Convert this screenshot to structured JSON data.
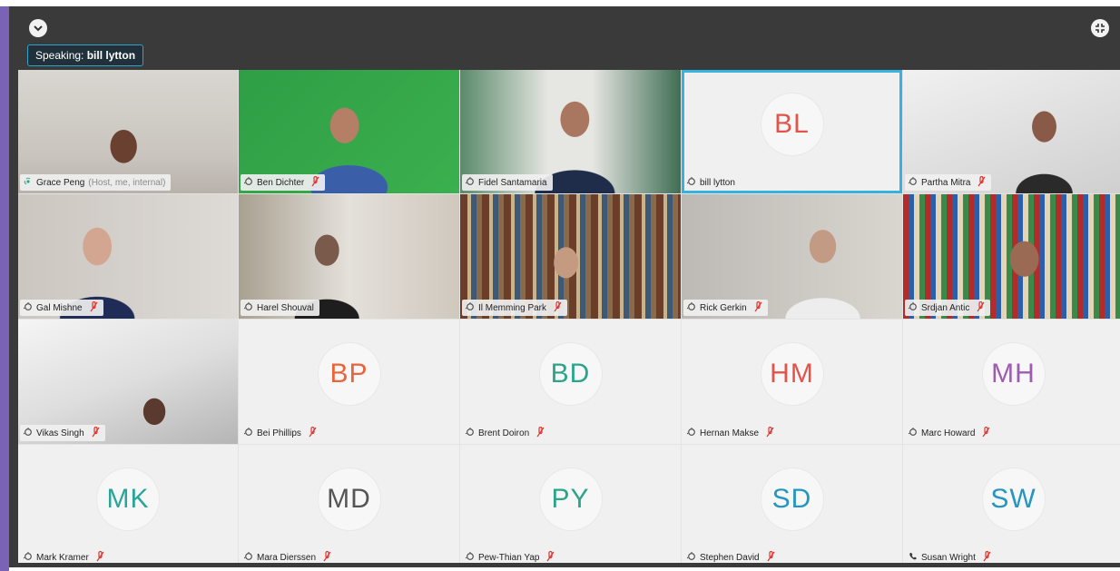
{
  "window": {
    "speaking_prefix": "Speaking:",
    "speaking_name": "bill lytton",
    "collapse_icon": "chevron-down-icon",
    "fullscreen_icon": "exit-fullscreen-icon"
  },
  "colors": {
    "accent": "#35b2dd",
    "mute_red": "#e0322d",
    "window_bg": "#3a3a3a",
    "purple_strip": "#7a62b5"
  },
  "participants": [
    {
      "name": "Grace Peng",
      "note": "(Host, me, internal)",
      "type": "video",
      "audio": "speaking",
      "muted": false
    },
    {
      "name": "Ben Dichter",
      "type": "video",
      "audio": "mic",
      "muted": true
    },
    {
      "name": "Fidel Santamaria",
      "type": "video",
      "audio": "mic",
      "muted": false
    },
    {
      "name": "bill lytton",
      "initials": "BL",
      "initials_color": "#e0544a",
      "type": "avatar",
      "audio": "mic",
      "muted": false,
      "active": true
    },
    {
      "name": "Partha Mitra",
      "type": "video",
      "audio": "mic",
      "muted": true
    },
    {
      "name": "Gal Mishne",
      "type": "video",
      "audio": "mic",
      "muted": true
    },
    {
      "name": "Harel Shouval",
      "type": "video",
      "audio": "mic",
      "muted": false
    },
    {
      "name": "Il Memming Park",
      "type": "video",
      "audio": "mic",
      "muted": true
    },
    {
      "name": "Rick Gerkin",
      "type": "video",
      "audio": "mic",
      "muted": true
    },
    {
      "name": "Srdjan Antic",
      "type": "video",
      "audio": "mic",
      "muted": true
    },
    {
      "name": "Vikas Singh",
      "type": "video",
      "audio": "mic",
      "muted": true
    },
    {
      "name": "Bei Phillips",
      "initials": "BP",
      "initials_color": "#e8643c",
      "type": "avatar",
      "audio": "mic",
      "muted": true
    },
    {
      "name": "Brent Doiron",
      "initials": "BD",
      "initials_color": "#2aa58a",
      "type": "avatar",
      "audio": "mic",
      "muted": true
    },
    {
      "name": "Hernan Makse",
      "initials": "HM",
      "initials_color": "#e0544a",
      "type": "avatar",
      "audio": "mic",
      "muted": true
    },
    {
      "name": "Marc Howard",
      "initials": "MH",
      "initials_color": "#9c5cb0",
      "type": "avatar",
      "audio": "mic",
      "muted": true
    },
    {
      "name": "Mark Kramer",
      "initials": "MK",
      "initials_color": "#2aa59a",
      "type": "avatar",
      "audio": "mic",
      "muted": true
    },
    {
      "name": "Mara Dierssen",
      "initials": "MD",
      "initials_color": "#555555",
      "type": "avatar",
      "audio": "mic",
      "muted": true
    },
    {
      "name": "Pew-Thian Yap",
      "initials": "PY",
      "initials_color": "#2aa58a",
      "type": "avatar",
      "audio": "mic",
      "muted": true
    },
    {
      "name": "Stephen David",
      "initials": "SD",
      "initials_color": "#2596c0",
      "type": "avatar",
      "audio": "mic",
      "muted": true
    },
    {
      "name": "Susan Wright",
      "initials": "SW",
      "initials_color": "#2596c0",
      "type": "avatar",
      "audio": "phone",
      "muted": true
    }
  ]
}
